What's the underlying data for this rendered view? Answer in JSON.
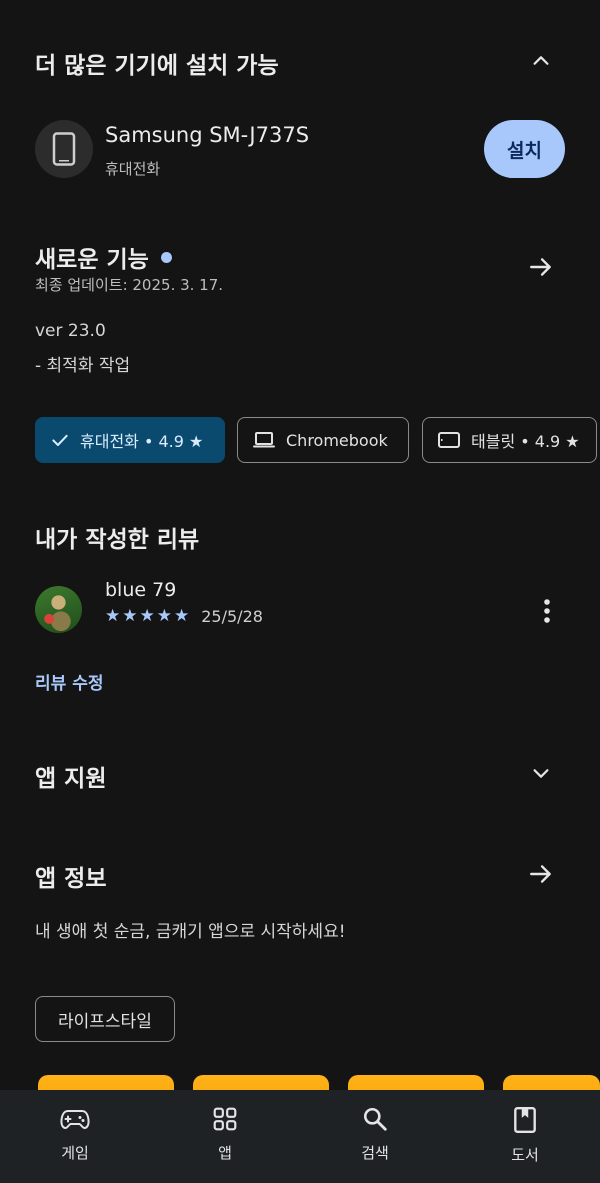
{
  "install_section": {
    "title": "더 많은 기기에 설치 가능",
    "device_name": "Samsung SM-J737S",
    "device_type": "휴대전화",
    "install_label": "설치"
  },
  "whats_new": {
    "title": "새로운 기능",
    "updated": "최종 업데이트: 2025. 3. 17.",
    "version": "ver 23.0",
    "notes": "- 최적화 작업"
  },
  "device_chips": [
    {
      "label": "휴대전화 • 4.9 ★",
      "icon": "check-icon",
      "selected": true
    },
    {
      "label": "Chromebook",
      "icon": "laptop-icon",
      "selected": false
    },
    {
      "label": "태블릿 • 4.9 ★",
      "icon": "tablet-icon",
      "selected": false
    }
  ],
  "my_review": {
    "title": "내가 작성한 리뷰",
    "user": "blue 79",
    "rating": 5,
    "date": "25/5/28",
    "edit_label": "리뷰 수정"
  },
  "app_support": {
    "title": "앱 지원"
  },
  "app_info": {
    "title": "앱 정보",
    "description": "내 생애 첫 순금, 금캐기 앱으로 시작하세요!",
    "category_tag": "라이프스타일"
  },
  "bottom_nav": [
    {
      "label": "게임",
      "icon": "gamepad-icon"
    },
    {
      "label": "앱",
      "icon": "apps-grid-icon"
    },
    {
      "label": "검색",
      "icon": "search-icon"
    },
    {
      "label": "도서",
      "icon": "book-icon"
    }
  ],
  "colors": {
    "background": "#141414",
    "accent": "#a8c7fa",
    "selected_chip": "#0b4a6f",
    "card": "#ffb31a"
  }
}
